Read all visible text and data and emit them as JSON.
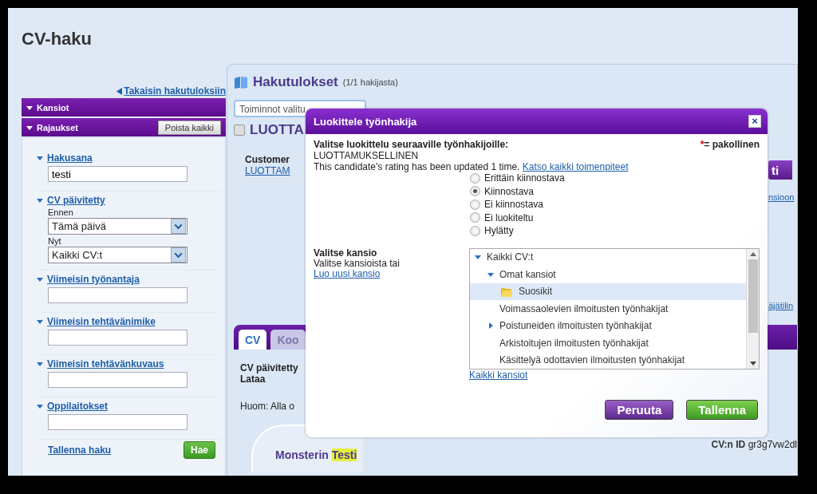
{
  "page_title": "CV-haku",
  "sidebar": {
    "back_link": "Takaisin hakutuloksiin",
    "bars": [
      {
        "label": "Kansiot",
        "expanded": true
      },
      {
        "label": "Rajaukset",
        "expanded": true,
        "button": "Poista kaikki"
      }
    ],
    "sections": [
      {
        "kind": "text",
        "label": "Hakusana",
        "expanded": true,
        "value": "testi"
      },
      {
        "kind": "dates",
        "label": "CV päivitetty",
        "expanded": true,
        "selects": [
          {
            "label": "Ennen",
            "value": "Tämä päivä"
          },
          {
            "label": "Nyt",
            "value": "Kaikki CV:t"
          }
        ]
      },
      {
        "kind": "text",
        "label": "Viimeisin työnantaja",
        "expanded": true
      },
      {
        "kind": "text",
        "label": "Viimeisin tehtävänimike",
        "expanded": true
      },
      {
        "kind": "text",
        "label": "Viimeisin tehtävänkuvaus",
        "expanded": true
      },
      {
        "kind": "text",
        "label": "Oppilaitokset",
        "expanded": true
      }
    ],
    "save_link": "Tallenna haku",
    "search_button": "Hae"
  },
  "results": {
    "title": "Hakutulokset",
    "count": "(1/1 hakijasta)",
    "actions_select": "Toiminnot valitu",
    "candidate_checked": false,
    "candidate_heading": "LUOTTA",
    "customer_label": "Customer",
    "customer_link": "LUOTTAM",
    "side_button": "ti",
    "side_link_1": "nsioon",
    "side_link_2": "äjätilin",
    "tabs": [
      {
        "label": "CV",
        "selected": true
      },
      {
        "label": "Koo",
        "selected": false
      }
    ],
    "cv_updated": "CV päivitetty",
    "download": "Lataa",
    "note": "Huom: Alla o",
    "cv_id_label": "CV:n ID",
    "cv_id": "gr3g7vw2dl",
    "cv_name": "Monsterin",
    "cv_highlight": "Testi"
  },
  "dialog": {
    "title": "Luokittele työnhakija",
    "close": "×",
    "prompt": "Valitse luokittelu seuraaville työnhakijoille:",
    "required_note": "*= pakollinen",
    "candidate": "LUOTTAMUKSELLINEN",
    "history_text": "This candidate's rating has been updated 1 time.",
    "history_link": "Katso kaikki toimenpiteet",
    "ratings": [
      {
        "label": "Erittäin kiinnostava",
        "selected": false
      },
      {
        "label": "Kiinnostava",
        "selected": true
      },
      {
        "label": "Ei kiinnostava",
        "selected": false
      },
      {
        "label": "Ei luokiteltu",
        "selected": false
      },
      {
        "label": "Hylätty",
        "selected": false
      }
    ],
    "folder_label": "Valitse kansio",
    "folder_hint": "Valitse kansioista tai",
    "folder_create_link": "Luo uusi kansio",
    "folders": [
      {
        "label": "Kaikki CV:t",
        "expanded": true,
        "selected": false,
        "children": [
          {
            "label": "Omat kansiot",
            "expanded": true,
            "selected": false,
            "children": [
              {
                "label": "Suosikit",
                "kind": "folder",
                "selected": true
              }
            ]
          },
          {
            "label": "Voimassaolevien ilmoitusten työnhakijat",
            "selected": false
          },
          {
            "label": "Poistuneiden ilmoitusten työnhakijat",
            "expanded": false,
            "selected": false
          },
          {
            "label": "Arkistoitujen ilmoitusten työnhakijat",
            "selected": false
          },
          {
            "label": "Käsittelyä odottavien ilmoitusten työnhakijat",
            "selected": false
          }
        ]
      }
    ],
    "all_folders_link": "Kaikki kansiot",
    "cancel_button": "Peruuta",
    "save_button": "Tallenna"
  }
}
